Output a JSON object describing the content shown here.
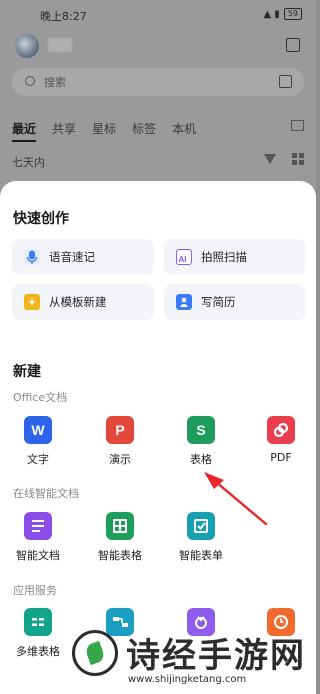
{
  "status_bar": {
    "time": "晚上8:27",
    "battery": "59"
  },
  "search": {
    "placeholder": "搜索"
  },
  "tabs": [
    {
      "label": "最近",
      "active": true
    },
    {
      "label": "共享"
    },
    {
      "label": "星标"
    },
    {
      "label": "标签"
    },
    {
      "label": "本机"
    }
  ],
  "filter_label": "七天内",
  "sheet": {
    "quick_create": {
      "title": "快速创作",
      "items": [
        {
          "label": "语音速记",
          "icon": "microphone-icon",
          "color": "#3b7cf5"
        },
        {
          "label": "拍照扫描",
          "icon": "ai-scan-icon",
          "color": "#7a63f0"
        },
        {
          "label": "从模板新建",
          "icon": "template-icon",
          "color": "#f2b619"
        },
        {
          "label": "写简历",
          "icon": "resume-icon",
          "color": "#3b7cf5"
        }
      ]
    },
    "new": {
      "title": "新建",
      "office_group": "Office文档",
      "office_apps": [
        {
          "label": "文字",
          "glyph": "W",
          "color": "#2d63e8"
        },
        {
          "label": "演示",
          "glyph": "P",
          "color": "#e2473a"
        },
        {
          "label": "表格",
          "glyph": "S",
          "color": "#1e9c5b"
        },
        {
          "label": "PDF",
          "glyph": "",
          "color": "#ea3d4d"
        }
      ],
      "online_group": "在线智能文档",
      "online_apps": [
        {
          "label": "智能文档",
          "glyph": "",
          "color": "#8a4de8"
        },
        {
          "label": "智能表格",
          "glyph": "",
          "color": "#1e9c5b"
        },
        {
          "label": "智能表单",
          "glyph": "",
          "color": "#16a0b2"
        }
      ],
      "service_group": "应用服务",
      "service_apps": [
        {
          "label": "多维表格",
          "color": "#12a48a"
        },
        {
          "label": "",
          "color": "#1b9fc0"
        },
        {
          "label": "",
          "color": "#8e5df0"
        },
        {
          "label": "",
          "color": "#f26a2d"
        }
      ]
    }
  },
  "watermark": {
    "text": "诗经手游网",
    "url": "www.shijingketang.com"
  }
}
